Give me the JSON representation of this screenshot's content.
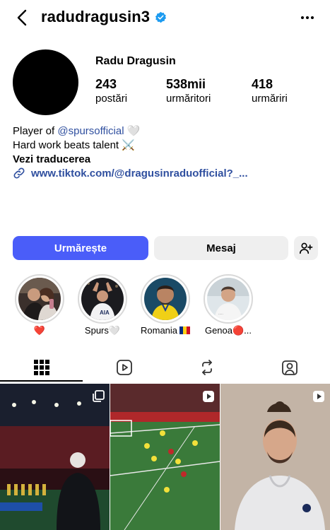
{
  "header": {
    "username": "radudragusin3",
    "verified_icon": "verified-badge-icon",
    "back_icon": "chevron-left-icon",
    "more_icon": "more-horizontal-icon"
  },
  "profile": {
    "full_name": "Radu Dragusin",
    "stats": [
      {
        "value": "243",
        "label": "postări"
      },
      {
        "value": "538mii",
        "label": "urmăritori"
      },
      {
        "value": "418",
        "label": "urmăriri"
      }
    ]
  },
  "bio": {
    "line1_prefix": "Player of ",
    "line1_mention": "@spursofficial",
    "line1_emoji": "🤍",
    "line2_text": "Hard work beats talent",
    "line2_emoji": "⚔️",
    "translate": "Vezi traducerea",
    "link": "www.tiktok.com/@dragusinraduofficial?_..."
  },
  "actions": {
    "follow": "Urmărește",
    "message": "Mesaj",
    "add_user_icon": "add-user-icon"
  },
  "highlights": [
    {
      "label": "❤️"
    },
    {
      "label": "Spurs🤍"
    },
    {
      "label": "Romania"
    },
    {
      "label": "Genoa🔴..."
    }
  ],
  "tabs": [
    {
      "icon": "grid-icon",
      "active": true
    },
    {
      "icon": "reels-icon",
      "active": false
    },
    {
      "icon": "repost-icon",
      "active": false
    },
    {
      "icon": "tagged-icon",
      "active": false
    }
  ],
  "colors": {
    "accent": "#4a5df9",
    "link": "#2f4f9f",
    "verified": "#1d9bf0",
    "button_secondary": "#efefef"
  }
}
